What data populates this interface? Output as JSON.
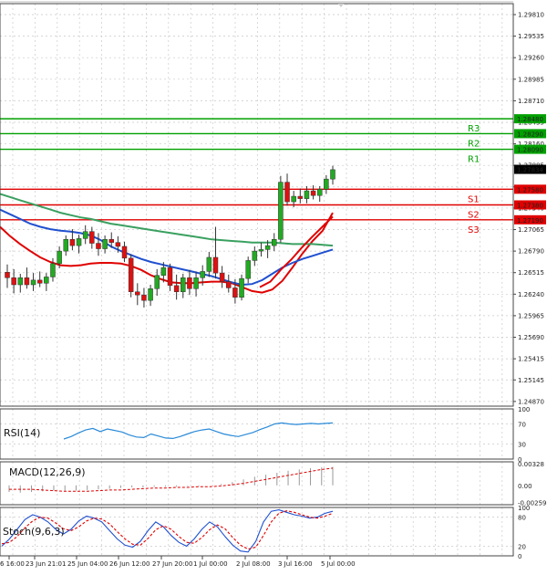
{
  "chart_data": [
    {
      "type": "candlestick",
      "panel": "price",
      "x_tick_labels": [
        "6 16:00",
        "23 Jun 21:01",
        "25 Jun 04:00",
        "26 Jun 12:00",
        "27 Jun 20:00",
        "1 Jul 00:00",
        "2 Jul 08:00",
        "3 Jul 16:00",
        "5 Jul 00:00"
      ],
      "y_ticks": [
        1.2981,
        1.29535,
        1.2926,
        1.28985,
        1.2871,
        1.28435,
        1.2816,
        1.27885,
        1.2761,
        1.2734,
        1.27065,
        1.2679,
        1.26515,
        1.2624,
        1.25965,
        1.2569,
        1.25415,
        1.25145,
        1.2487
      ],
      "ylim": [
        1.2481,
        1.2995
      ],
      "current_price": 1.27834,
      "levels": [
        {
          "label": "R3",
          "value": 1.2848,
          "color": "#00a000"
        },
        {
          "label": "R2",
          "value": 1.2829,
          "color": "#00a000"
        },
        {
          "label": "R1",
          "value": 1.2809,
          "color": "#00a000"
        },
        {
          "label": "S1",
          "value": 1.2758,
          "color": "#e00000"
        },
        {
          "label": "S2",
          "value": 1.2738,
          "color": "#e00000"
        },
        {
          "label": "S3",
          "value": 1.2719,
          "color": "#e00000"
        }
      ],
      "moving_averages": [
        {
          "color": "#e00000",
          "values": [
            1.271,
            1.2698,
            1.2688,
            1.2679,
            1.2671,
            1.2665,
            1.2661,
            1.266,
            1.2661,
            1.2663,
            1.2664,
            1.2664,
            1.2663,
            1.266,
            1.2655,
            1.2648,
            1.2643,
            1.2639,
            1.2638,
            1.2638,
            1.2639,
            1.264,
            1.264,
            1.2638,
            1.2633,
            1.2628,
            1.2626,
            1.263,
            1.2641,
            1.2658,
            1.2676,
            1.2692,
            1.2705,
            1.2728
          ]
        },
        {
          "color": "#2050d0",
          "values": [
            1.2732,
            1.2726,
            1.272,
            1.2714,
            1.271,
            1.2707,
            1.2705,
            1.2704,
            1.2702,
            1.2699,
            1.2693,
            1.2685,
            1.2679,
            1.2674,
            1.2669,
            1.2665,
            1.2662,
            1.2659,
            1.2656,
            1.2653,
            1.265,
            1.2647,
            1.2643,
            1.2639,
            1.2636,
            1.2637,
            1.2642,
            1.265,
            1.2658,
            1.2664,
            1.2669,
            1.2673,
            1.2677,
            1.2681
          ]
        },
        {
          "color": "#3aa060",
          "values": [
            1.2752,
            1.2748,
            1.2744,
            1.274,
            1.2736,
            1.2732,
            1.2728,
            1.2725,
            1.2722,
            1.272,
            1.2717,
            1.2714,
            1.2712,
            1.271,
            1.2708,
            1.2706,
            1.2704,
            1.2702,
            1.27,
            1.2698,
            1.2696,
            1.2694,
            1.2693,
            1.2692,
            1.2691,
            1.269,
            1.269,
            1.269,
            1.2689,
            1.2688,
            1.2688,
            1.2688,
            1.2687,
            1.2686
          ]
        },
        {
          "color": "#e00000",
          "values": [
            1.2633,
            1.264,
            1.2655,
            1.2668,
            1.2683,
            1.2697,
            1.271,
            1.2723
          ]
        }
      ],
      "candles": [
        {
          "o": 1.2652,
          "h": 1.2662,
          "l": 1.2632,
          "c": 1.2645
        },
        {
          "o": 1.2645,
          "h": 1.2656,
          "l": 1.2625,
          "c": 1.2636
        },
        {
          "o": 1.2636,
          "h": 1.265,
          "l": 1.2626,
          "c": 1.2645
        },
        {
          "o": 1.2645,
          "h": 1.2658,
          "l": 1.2631,
          "c": 1.2636
        },
        {
          "o": 1.2636,
          "h": 1.2651,
          "l": 1.2628,
          "c": 1.2642
        },
        {
          "o": 1.2642,
          "h": 1.2653,
          "l": 1.2633,
          "c": 1.2638
        },
        {
          "o": 1.2638,
          "h": 1.2651,
          "l": 1.2628,
          "c": 1.2646
        },
        {
          "o": 1.2646,
          "h": 1.267,
          "l": 1.264,
          "c": 1.2663
        },
        {
          "o": 1.2663,
          "h": 1.2685,
          "l": 1.2657,
          "c": 1.2679
        },
        {
          "o": 1.2679,
          "h": 1.2699,
          "l": 1.2673,
          "c": 1.2694
        },
        {
          "o": 1.2694,
          "h": 1.2707,
          "l": 1.268,
          "c": 1.2686
        },
        {
          "o": 1.2686,
          "h": 1.27,
          "l": 1.2676,
          "c": 1.2695
        },
        {
          "o": 1.2695,
          "h": 1.2712,
          "l": 1.2688,
          "c": 1.2704
        },
        {
          "o": 1.2704,
          "h": 1.271,
          "l": 1.2682,
          "c": 1.2689
        },
        {
          "o": 1.2689,
          "h": 1.2702,
          "l": 1.2673,
          "c": 1.2682
        },
        {
          "o": 1.2682,
          "h": 1.2699,
          "l": 1.2676,
          "c": 1.2694
        },
        {
          "o": 1.2694,
          "h": 1.2703,
          "l": 1.2683,
          "c": 1.269
        },
        {
          "o": 1.269,
          "h": 1.2698,
          "l": 1.2677,
          "c": 1.2685
        },
        {
          "o": 1.2685,
          "h": 1.2691,
          "l": 1.2665,
          "c": 1.267
        },
        {
          "o": 1.267,
          "h": 1.2675,
          "l": 1.262,
          "c": 1.2627
        },
        {
          "o": 1.2627,
          "h": 1.2638,
          "l": 1.261,
          "c": 1.2623
        },
        {
          "o": 1.2623,
          "h": 1.2632,
          "l": 1.2607,
          "c": 1.2616
        },
        {
          "o": 1.2616,
          "h": 1.2636,
          "l": 1.2609,
          "c": 1.2631
        },
        {
          "o": 1.2631,
          "h": 1.2656,
          "l": 1.2622,
          "c": 1.2648
        },
        {
          "o": 1.2648,
          "h": 1.2665,
          "l": 1.2639,
          "c": 1.2658
        },
        {
          "o": 1.2658,
          "h": 1.2663,
          "l": 1.2628,
          "c": 1.2635
        },
        {
          "o": 1.2635,
          "h": 1.2649,
          "l": 1.2617,
          "c": 1.2627
        },
        {
          "o": 1.2627,
          "h": 1.265,
          "l": 1.2619,
          "c": 1.2645
        },
        {
          "o": 1.2645,
          "h": 1.2655,
          "l": 1.2623,
          "c": 1.2631
        },
        {
          "o": 1.2631,
          "h": 1.2653,
          "l": 1.2621,
          "c": 1.2645
        },
        {
          "o": 1.2645,
          "h": 1.2661,
          "l": 1.2635,
          "c": 1.2653
        },
        {
          "o": 1.2653,
          "h": 1.2678,
          "l": 1.2646,
          "c": 1.2671
        },
        {
          "o": 1.2671,
          "h": 1.271,
          "l": 1.2644,
          "c": 1.2651
        },
        {
          "o": 1.2651,
          "h": 1.266,
          "l": 1.2632,
          "c": 1.264
        },
        {
          "o": 1.264,
          "h": 1.2649,
          "l": 1.2626,
          "c": 1.2632
        },
        {
          "o": 1.2632,
          "h": 1.2643,
          "l": 1.2612,
          "c": 1.262
        },
        {
          "o": 1.262,
          "h": 1.2649,
          "l": 1.2616,
          "c": 1.2644
        },
        {
          "o": 1.2644,
          "h": 1.2672,
          "l": 1.2638,
          "c": 1.2667
        },
        {
          "o": 1.2667,
          "h": 1.2685,
          "l": 1.266,
          "c": 1.2679
        },
        {
          "o": 1.2679,
          "h": 1.269,
          "l": 1.2672,
          "c": 1.2681
        },
        {
          "o": 1.2681,
          "h": 1.2693,
          "l": 1.267,
          "c": 1.2686
        },
        {
          "o": 1.2686,
          "h": 1.2702,
          "l": 1.2679,
          "c": 1.2694
        },
        {
          "o": 1.2694,
          "h": 1.2775,
          "l": 1.269,
          "c": 1.2767
        },
        {
          "o": 1.2767,
          "h": 1.2778,
          "l": 1.2737,
          "c": 1.2742
        },
        {
          "o": 1.2742,
          "h": 1.2756,
          "l": 1.2735,
          "c": 1.2749
        },
        {
          "o": 1.2749,
          "h": 1.2759,
          "l": 1.274,
          "c": 1.2746
        },
        {
          "o": 1.2746,
          "h": 1.2762,
          "l": 1.274,
          "c": 1.2756
        },
        {
          "o": 1.2756,
          "h": 1.2763,
          "l": 1.2745,
          "c": 1.275
        },
        {
          "o": 1.275,
          "h": 1.2762,
          "l": 1.2742,
          "c": 1.2758
        },
        {
          "o": 1.2758,
          "h": 1.2776,
          "l": 1.2752,
          "c": 1.2771
        },
        {
          "o": 1.2771,
          "h": 1.2788,
          "l": 1.2764,
          "c": 1.2783
        }
      ]
    },
    {
      "type": "line",
      "panel": "rsi",
      "title": "RSI(14)",
      "y_ticks": [
        100,
        70,
        30,
        0
      ],
      "ylim": [
        0,
        100
      ],
      "values": [
        40,
        45,
        52,
        58,
        61,
        55,
        60,
        57,
        54,
        48,
        44,
        43,
        50,
        46,
        42,
        41,
        45,
        50,
        55,
        58,
        60,
        55,
        50,
        47,
        45,
        49,
        53,
        59,
        64,
        70,
        72,
        70,
        69,
        70,
        71,
        70,
        71,
        72
      ]
    },
    {
      "type": "bar",
      "panel": "macd",
      "title": "MACD(12,26,9)",
      "y_ticks": [
        0.00328,
        0.0,
        -0.002592
      ],
      "ylim": [
        -0.00292,
        0.00355
      ],
      "values": [
        -0.001,
        -0.0011,
        -0.001,
        -0.0009,
        -0.0008,
        -0.0008,
        -0.0008,
        -0.0007,
        -0.0006,
        -0.0005,
        -0.0004,
        -0.0003,
        -0.0003,
        -0.0002,
        -0.0002,
        -0.0002,
        -0.0001,
        -0.0001,
        0.0,
        0.0002,
        0.0005,
        0.0009,
        0.0013,
        0.0016,
        0.0019,
        0.0022,
        0.0024,
        0.0026,
        0.0027,
        0.0028
      ],
      "signal": [
        -0.0006,
        -0.0006,
        -0.0006,
        -0.0007,
        -0.0008,
        -0.0009,
        -0.0009,
        -0.0009,
        -0.0008,
        -0.0007,
        -0.0007,
        -0.0006,
        -0.0005,
        -0.0004,
        -0.0004,
        -0.0003,
        -0.0003,
        -0.0002,
        -0.0002,
        -0.0001,
        0.0001,
        0.0003,
        0.0006,
        0.0009,
        0.0012,
        0.0015,
        0.0018,
        0.0021,
        0.0024,
        0.0026
      ]
    },
    {
      "type": "line",
      "panel": "stoch",
      "title": "Stoch(9,6,3)",
      "y_ticks": [
        100,
        80,
        20,
        0
      ],
      "ylim": [
        0,
        100
      ],
      "series": [
        {
          "color": "#2050d0",
          "values": [
            20,
            35,
            55,
            75,
            85,
            80,
            70,
            55,
            45,
            55,
            72,
            82,
            78,
            70,
            52,
            35,
            22,
            18,
            30,
            52,
            70,
            60,
            42,
            28,
            20,
            35,
            55,
            70,
            60,
            40,
            22,
            10,
            8,
            30,
            70,
            92,
            95,
            90,
            85,
            82,
            78,
            80,
            88,
            92
          ]
        },
        {
          "color": "#e00000",
          "values": [
            25,
            28,
            40,
            58,
            72,
            80,
            78,
            68,
            56,
            52,
            60,
            72,
            78,
            76,
            66,
            50,
            35,
            24,
            22,
            36,
            54,
            62,
            55,
            40,
            28,
            26,
            38,
            54,
            64,
            56,
            38,
            22,
            14,
            18,
            42,
            70,
            88,
            93,
            90,
            85,
            80,
            78,
            82,
            88
          ]
        }
      ]
    }
  ],
  "labels": {
    "price_now": "1.27834",
    "rsi_title": "RSI(14)",
    "macd_title": "MACD(12,26,9)",
    "stoch_title": "Stoch(9,6,3)"
  }
}
